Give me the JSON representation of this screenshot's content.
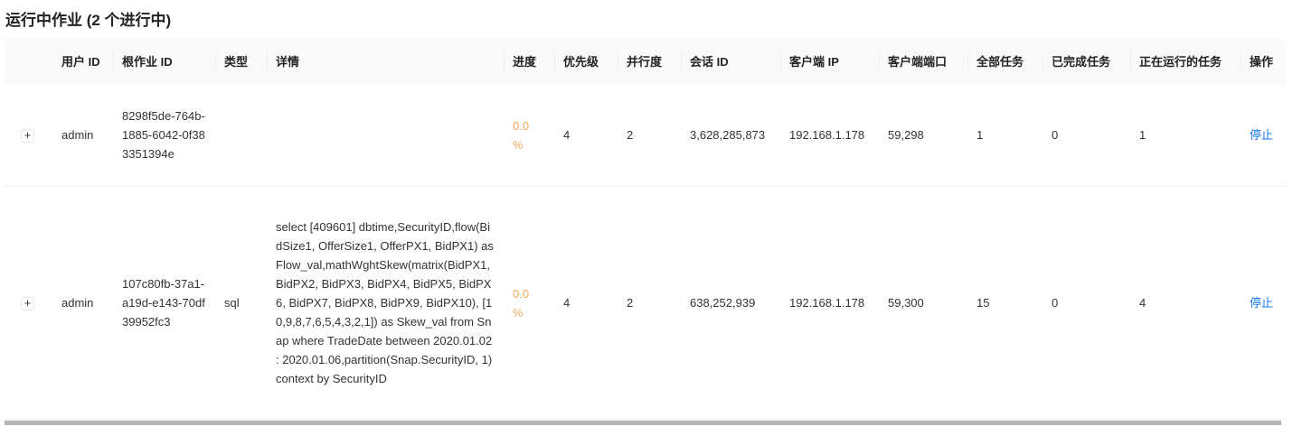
{
  "title": "运行中作业 (2 个进行中)",
  "columns": [
    "",
    "用户 ID",
    "根作业 ID",
    "类型",
    "详情",
    "进度",
    "优先级",
    "并行度",
    "会话 ID",
    "客户端 IP",
    "客户端端口",
    "全部任务",
    "已完成任务",
    "正在运行的任务",
    "操作"
  ],
  "rows": [
    {
      "user": "admin",
      "root": "8298f5de-764b-1885-6042-0f383351394e",
      "type": "",
      "detail": "",
      "progress": "0.0 %",
      "priority": "4",
      "parallel": "2",
      "session": "3,628,285,873",
      "ip": "192.168.1.178",
      "port": "59,298",
      "total": "1",
      "done": "0",
      "running": "1",
      "action": "停止"
    },
    {
      "user": "admin",
      "root": "107c80fb-37a1-a19d-e143-70df39952fc3",
      "type": "sql",
      "detail": "select [409601] dbtime,SecurityID,flow(BidSize1, OfferSize1, OfferPX1, BidPX1) as Flow_val,mathWghtSkew(matrix(BidPX1, BidPX2, BidPX3, BidPX4, BidPX5, BidPX6, BidPX7, BidPX8, BidPX9, BidPX10), [10,9,8,7,6,5,4,3,2,1]) as Skew_val from Snap where TradeDate between 2020.01.02 : 2020.01.06,partition(Snap.SecurityID, 1) context by SecurityID",
      "progress": "0.0 %",
      "priority": "4",
      "parallel": "2",
      "session": "638,252,939",
      "ip": "192.168.1.178",
      "port": "59,300",
      "total": "15",
      "done": "0",
      "running": "4",
      "action": "停止"
    }
  ],
  "expand_symbol": "+"
}
